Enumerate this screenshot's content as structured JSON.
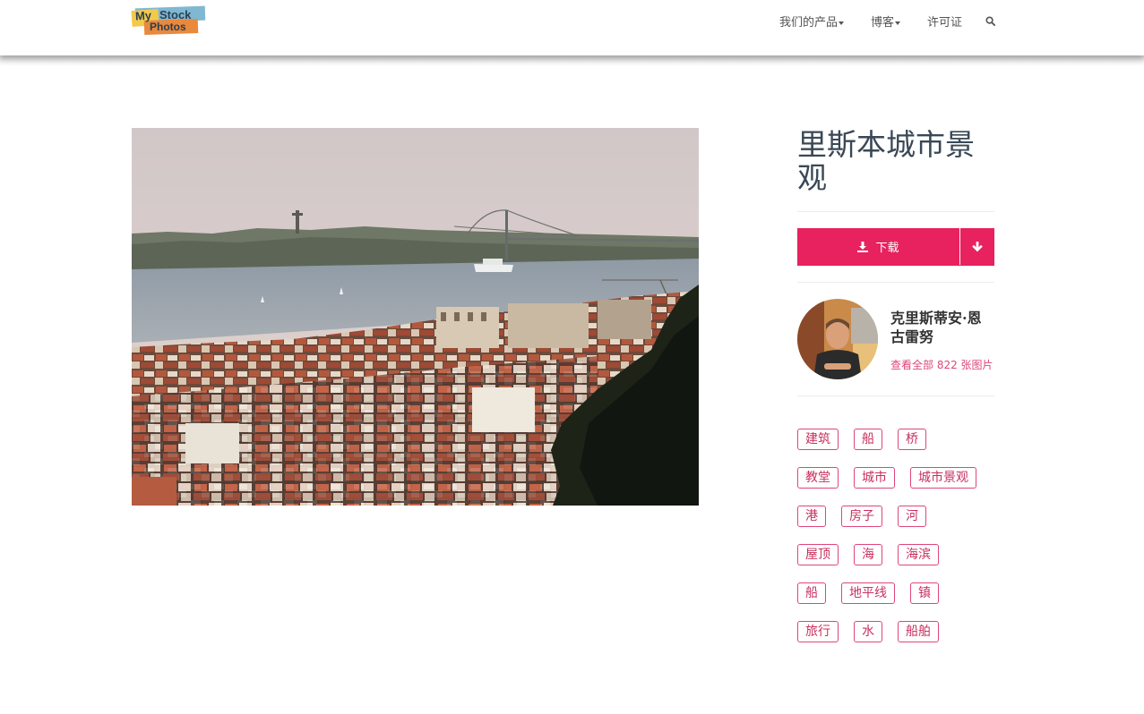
{
  "header": {
    "logo": {
      "word1": "My",
      "word2": "Stock",
      "word3": "Photos"
    },
    "nav": [
      {
        "label": "我们的产品",
        "has_dropdown": true
      },
      {
        "label": "博客",
        "has_dropdown": true
      },
      {
        "label": "许可证",
        "has_dropdown": false
      }
    ],
    "search_icon": "search-icon"
  },
  "photo": {
    "subject": "lisbon-cityscape"
  },
  "sidebar": {
    "title": "里斯本城市景观",
    "download": {
      "label": "下载",
      "icon": "download-icon",
      "toggle_icon": "arrow-down-icon"
    },
    "author": {
      "name": "克里斯蒂安·恩古雷努",
      "link": "查看全部 822 张图片"
    },
    "tags": [
      "建筑",
      "船",
      "桥",
      "教堂",
      "城市",
      "城市景观",
      "港",
      "房子",
      "河",
      "屋顶",
      "海",
      "海滨",
      "船",
      "地平线",
      "镇",
      "旅行",
      "水",
      "船舶"
    ]
  },
  "colors": {
    "accent": "#e8215f",
    "tag_border": "#e0457b",
    "title": "#3a4856"
  }
}
